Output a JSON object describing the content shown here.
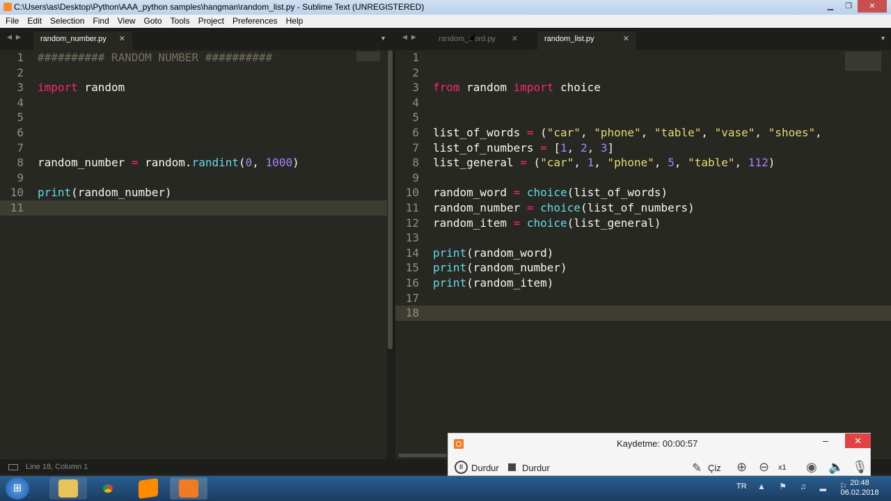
{
  "window": {
    "title": "C:\\Users\\as\\Desktop\\Python\\AAA_python samples\\hangman\\random_list.py - Sublime Text (UNREGISTERED)"
  },
  "menu": [
    "File",
    "Edit",
    "Selection",
    "Find",
    "View",
    "Goto",
    "Tools",
    "Project",
    "Preferences",
    "Help"
  ],
  "left_tabs": [
    {
      "label": "random_number.py"
    }
  ],
  "right_tabs": [
    {
      "label": "random_word.py"
    },
    {
      "label": "random_list.py"
    }
  ],
  "left_lines": [
    {
      "n": "1",
      "t": [
        [
          "cm",
          "########## RANDOM NUMBER ##########"
        ]
      ]
    },
    {
      "n": "2",
      "t": []
    },
    {
      "n": "3",
      "t": [
        [
          "kw",
          "import"
        ],
        [
          "p",
          " random"
        ]
      ]
    },
    {
      "n": "4",
      "t": []
    },
    {
      "n": "5",
      "t": []
    },
    {
      "n": "6",
      "t": []
    },
    {
      "n": "7",
      "t": []
    },
    {
      "n": "8",
      "t": [
        [
          "p",
          "random_number "
        ],
        [
          "op",
          "="
        ],
        [
          "p",
          " random."
        ],
        [
          "fn",
          "randint"
        ],
        [
          "p",
          "("
        ],
        [
          "num",
          "0"
        ],
        [
          "p",
          ", "
        ],
        [
          "num",
          "1000"
        ],
        [
          "p",
          ")"
        ]
      ]
    },
    {
      "n": "9",
      "t": []
    },
    {
      "n": "10",
      "t": [
        [
          "fn",
          "print"
        ],
        [
          "p",
          "(random_number)"
        ]
      ]
    },
    {
      "n": "11",
      "t": []
    }
  ],
  "right_lines": [
    {
      "n": "1",
      "t": []
    },
    {
      "n": "2",
      "t": []
    },
    {
      "n": "3",
      "t": [
        [
          "kw",
          "from"
        ],
        [
          "p",
          " random "
        ],
        [
          "kw",
          "import"
        ],
        [
          "p",
          " choice"
        ]
      ]
    },
    {
      "n": "4",
      "t": []
    },
    {
      "n": "5",
      "t": []
    },
    {
      "n": "6",
      "t": [
        [
          "p",
          "list_of_words "
        ],
        [
          "op",
          "="
        ],
        [
          "p",
          " ("
        ],
        [
          "str",
          "\"car\""
        ],
        [
          "p",
          ", "
        ],
        [
          "str",
          "\"phone\""
        ],
        [
          "p",
          ", "
        ],
        [
          "str",
          "\"table\""
        ],
        [
          "p",
          ", "
        ],
        [
          "str",
          "\"vase\""
        ],
        [
          "p",
          ", "
        ],
        [
          "str",
          "\"shoes\""
        ],
        [
          "p",
          ","
        ]
      ]
    },
    {
      "n": "7",
      "t": [
        [
          "p",
          "list_of_numbers "
        ],
        [
          "op",
          "="
        ],
        [
          "p",
          " ["
        ],
        [
          "num",
          "1"
        ],
        [
          "p",
          ", "
        ],
        [
          "num",
          "2"
        ],
        [
          "p",
          ", "
        ],
        [
          "num",
          "3"
        ],
        [
          "p",
          "]"
        ]
      ]
    },
    {
      "n": "8",
      "t": [
        [
          "p",
          "list_general "
        ],
        [
          "op",
          "="
        ],
        [
          "p",
          " ("
        ],
        [
          "str",
          "\"car\""
        ],
        [
          "p",
          ", "
        ],
        [
          "num",
          "1"
        ],
        [
          "p",
          ", "
        ],
        [
          "str",
          "\"phone\""
        ],
        [
          "p",
          ", "
        ],
        [
          "num",
          "5"
        ],
        [
          "p",
          ", "
        ],
        [
          "str",
          "\"table\""
        ],
        [
          "p",
          ", "
        ],
        [
          "num",
          "112"
        ],
        [
          "p",
          ")"
        ]
      ]
    },
    {
      "n": "9",
      "t": []
    },
    {
      "n": "10",
      "t": [
        [
          "p",
          "random_word "
        ],
        [
          "op",
          "="
        ],
        [
          "p",
          " "
        ],
        [
          "fn",
          "choice"
        ],
        [
          "p",
          "(list_of_words)"
        ]
      ]
    },
    {
      "n": "11",
      "t": [
        [
          "p",
          "random_number "
        ],
        [
          "op",
          "="
        ],
        [
          "p",
          " "
        ],
        [
          "fn",
          "choice"
        ],
        [
          "p",
          "(list_of_numbers)"
        ]
      ]
    },
    {
      "n": "12",
      "t": [
        [
          "p",
          "random_item "
        ],
        [
          "op",
          "="
        ],
        [
          "p",
          " "
        ],
        [
          "fn",
          "choice"
        ],
        [
          "p",
          "(list_general)"
        ]
      ]
    },
    {
      "n": "13",
      "t": []
    },
    {
      "n": "14",
      "t": [
        [
          "fn",
          "print"
        ],
        [
          "p",
          "(random_word)"
        ]
      ]
    },
    {
      "n": "15",
      "t": [
        [
          "fn",
          "print"
        ],
        [
          "p",
          "(random_number)"
        ]
      ]
    },
    {
      "n": "16",
      "t": [
        [
          "fn",
          "print"
        ],
        [
          "p",
          "(random_item)"
        ]
      ]
    },
    {
      "n": "17",
      "t": []
    },
    {
      "n": "18",
      "t": []
    }
  ],
  "status": {
    "text": "Line 18, Column 1"
  },
  "recorder": {
    "title": "Kaydetme:  00:00:57",
    "pause_label": "Durdur",
    "stop_label": "Durdur",
    "draw_label": "Çiz",
    "zoom_label": "x1",
    "close": "✕",
    "minimize": "–"
  },
  "taskbar": {
    "lang": "TR",
    "time": "20:48",
    "date": "06.02.2018"
  }
}
